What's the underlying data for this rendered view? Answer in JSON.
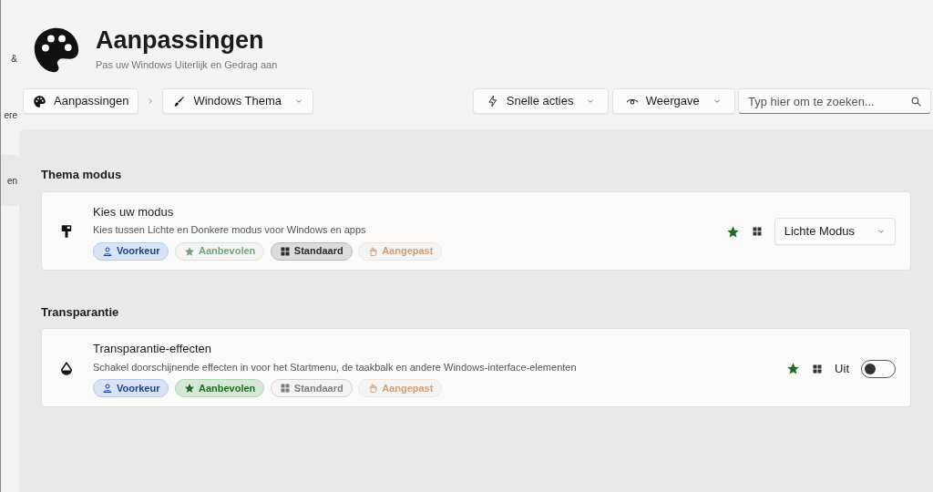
{
  "sidebar": {
    "items": [
      {
        "label": "&",
        "selected": false
      },
      {
        "label": "ere",
        "selected": false
      },
      {
        "label": "en",
        "selected": true
      }
    ]
  },
  "header": {
    "title": "Aanpassingen",
    "subtitle": "Pas uw Windows Uiterlijk en Gedrag aan"
  },
  "breadcrumb": [
    {
      "label": "Aanpassingen",
      "kind": "palette"
    },
    {
      "label": "Windows Thema",
      "kind": "brush"
    }
  ],
  "toolbar": {
    "buttons": [
      {
        "label": "Snelle acties",
        "kind": "bolt"
      },
      {
        "label": "Weergave",
        "kind": "eye"
      }
    ],
    "search": {
      "placeholder": "Typ hier om te zoeken..."
    }
  },
  "sections": [
    {
      "title": "Thema modus",
      "settings": [
        {
          "title": "Kies uw modus",
          "description": "Kies tussen Lichte en Donkere modus voor Windows en apps",
          "kind": "mode",
          "tags": [
            {
              "label": "Voorkeur",
              "kind": "voorkeur",
              "active": true
            },
            {
              "label": "Aanbevolen",
              "kind": "aanbevolen",
              "active": false
            },
            {
              "label": "Standaard",
              "kind": "standaard",
              "active": true
            },
            {
              "label": "Aangepast",
              "kind": "aangepast",
              "active": false
            }
          ],
          "control": {
            "kind": "dropdown",
            "value": "Lichte Modus"
          }
        }
      ]
    },
    {
      "title": "Transparantie",
      "settings": [
        {
          "title": "Transparantie-effecten",
          "description": "Schakel doorschijnende effecten in voor het Startmenu, de taakbalk en andere Windows-interface-elementen",
          "kind": "transparency",
          "tags": [
            {
              "label": "Voorkeur",
              "kind": "voorkeur",
              "active": true
            },
            {
              "label": "Aanbevolen",
              "kind": "aanbevolen",
              "active": true
            },
            {
              "label": "Standaard",
              "kind": "standaard",
              "active": false
            },
            {
              "label": "Aangepast",
              "kind": "aangepast",
              "active": false
            }
          ],
          "control": {
            "kind": "toggle",
            "label": "Uit",
            "on": false
          }
        }
      ]
    }
  ]
}
